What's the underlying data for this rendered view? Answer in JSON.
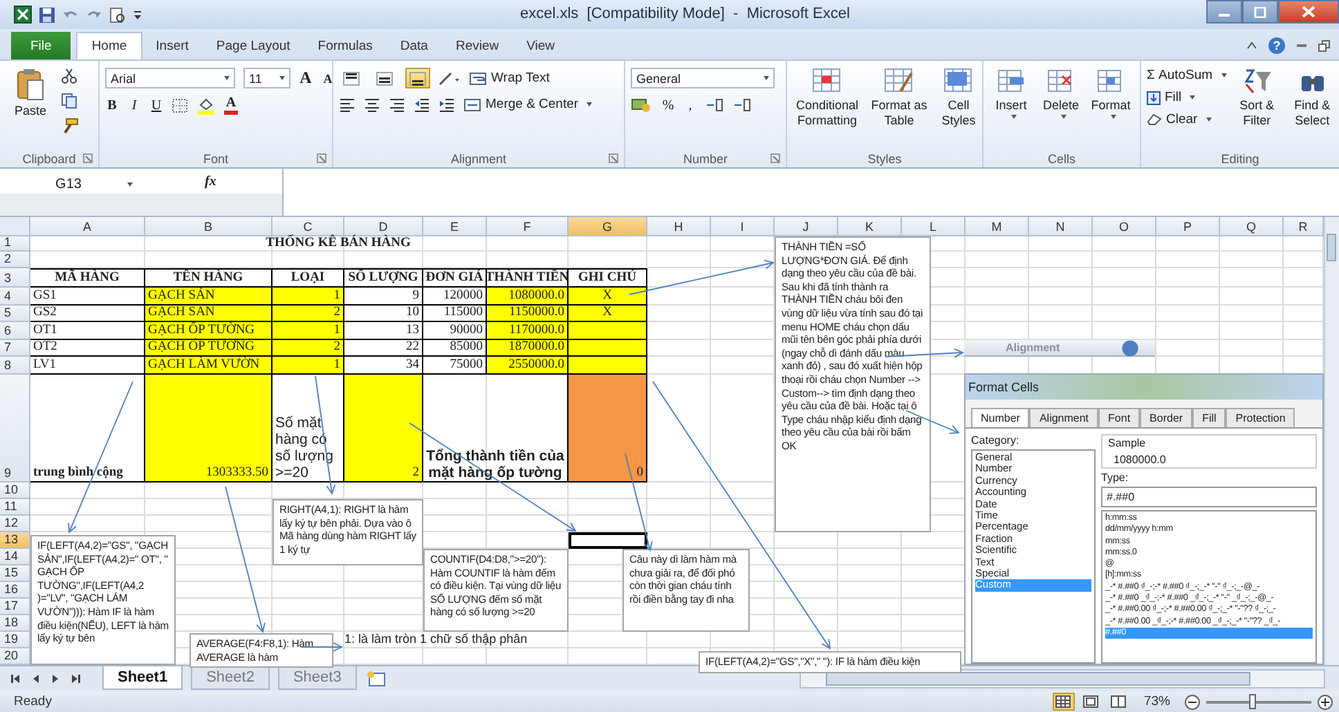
{
  "window": {
    "title": "excel.xls  [Compatibility Mode]  -  Microsoft Excel"
  },
  "ribbon_tabs": [
    {
      "label": "File",
      "kind": "file",
      "selected": false
    },
    {
      "label": "Home",
      "kind": "tab",
      "selected": true
    },
    {
      "label": "Insert",
      "kind": "tab",
      "selected": false
    },
    {
      "label": "Page Layout",
      "kind": "tab",
      "selected": false
    },
    {
      "label": "Formulas",
      "kind": "tab",
      "selected": false
    },
    {
      "label": "Data",
      "kind": "tab",
      "selected": false
    },
    {
      "label": "Review",
      "kind": "tab",
      "selected": false
    },
    {
      "label": "View",
      "kind": "tab",
      "selected": false
    }
  ],
  "help": "?",
  "ribbon": {
    "clipboard": {
      "paste": "Paste",
      "label": "Clipboard"
    },
    "font": {
      "name": "Arial",
      "size": "11",
      "grow": "A",
      "shrink": "A",
      "styles": [
        "B",
        "I",
        "U"
      ],
      "font_color": "A",
      "label": "Font"
    },
    "alignment": {
      "vertical": [
        {
          "selected": false
        },
        {
          "selected": false
        },
        {
          "selected": true
        }
      ],
      "wrap_text": "Wrap Text",
      "merge": "Merge & Center",
      "label": "Alignment"
    },
    "number": {
      "format": "General",
      "percent": "%",
      "comma": ",",
      "label": "Number"
    },
    "styles": {
      "buttons": [
        "Conditional Formatting",
        "Format as Table",
        "Cell Styles"
      ],
      "label": "Styles"
    },
    "cells": {
      "buttons": [
        "Insert",
        "Delete",
        "Format"
      ],
      "label": "Cells"
    },
    "editing": {
      "sigma": "Σ",
      "autosum": "AutoSum",
      "fill": "Fill",
      "clear": "Clear",
      "sort": "Sort & Filter",
      "find": "Find & Select",
      "label": "Editing"
    }
  },
  "formula_bar": {
    "name_box": "G13",
    "fx": "fx"
  },
  "sheet": {
    "columns": [
      {
        "label": "A",
        "selected": false
      },
      {
        "label": "B",
        "selected": false
      },
      {
        "label": "C",
        "selected": false
      },
      {
        "label": "D",
        "selected": false
      },
      {
        "label": "E",
        "selected": false
      },
      {
        "label": "F",
        "selected": false
      },
      {
        "label": "G",
        "selected": true
      },
      {
        "label": "H",
        "selected": false
      },
      {
        "label": "I",
        "selected": false
      },
      {
        "label": "J",
        "selected": false
      },
      {
        "label": "K",
        "selected": false
      },
      {
        "label": "L",
        "selected": false
      },
      {
        "label": "M",
        "selected": false
      },
      {
        "label": "N",
        "selected": false
      },
      {
        "label": "O",
        "selected": false
      },
      {
        "label": "P",
        "selected": false
      },
      {
        "label": "Q",
        "selected": false
      },
      {
        "label": "R",
        "selected": false
      }
    ],
    "rows": [
      {
        "number": "1",
        "selected": false
      },
      {
        "number": "2",
        "selected": false
      },
      {
        "number": "3",
        "selected": false
      },
      {
        "number": "4",
        "selected": false
      },
      {
        "number": "5",
        "selected": false
      },
      {
        "number": "6",
        "selected": false
      },
      {
        "number": "7",
        "selected": false
      },
      {
        "number": "8",
        "selected": false
      },
      {
        "number": "9",
        "selected": false
      },
      {
        "number": "10",
        "selected": false
      },
      {
        "number": "11",
        "selected": false
      },
      {
        "number": "12",
        "selected": false
      },
      {
        "number": "13",
        "selected": true
      },
      {
        "number": "14",
        "selected": false
      },
      {
        "number": "15",
        "selected": false
      },
      {
        "number": "16",
        "selected": false
      },
      {
        "number": "17",
        "selected": false
      },
      {
        "number": "18",
        "selected": false
      },
      {
        "number": "19",
        "selected": false,
        "text": "1: là làm tròn 1 chữ số thập phân"
      },
      {
        "number": "20",
        "selected": false
      }
    ],
    "title": "THỐNG KÊ BÁN HÀNG",
    "table": [
      {
        "kind": "header",
        "cells": [
          {
            "text": "MÃ HÀNG"
          },
          {
            "text": "TÊN HÀNG"
          },
          {
            "text": "LOẠI"
          },
          {
            "text": "SỐ LƯỢNG"
          },
          {
            "text": "ĐƠN GIÁ"
          },
          {
            "text": "THÀNH TIỀN"
          },
          {
            "text": "GHI CHÚ"
          }
        ]
      },
      {
        "kind": "data",
        "cells": [
          {
            "text": "GS1"
          },
          {
            "text": "GẠCH SẢN",
            "color": "#ffff00"
          },
          {
            "text": "1",
            "color": "#ffff00"
          },
          {
            "text": "9"
          },
          {
            "text": "120000"
          },
          {
            "text": "1080000.0",
            "color": "#ffff00"
          },
          {
            "text": "X",
            "color": "#ffff00"
          }
        ]
      },
      {
        "kind": "data",
        "cells": [
          {
            "text": "GS2"
          },
          {
            "text": "GẠCH SẢN",
            "color": "#ffff00"
          },
          {
            "text": "2",
            "color": "#ffff00"
          },
          {
            "text": "10"
          },
          {
            "text": "115000"
          },
          {
            "text": "1150000.0",
            "color": "#ffff00"
          },
          {
            "text": "X",
            "color": "#ffff00"
          }
        ]
      },
      {
        "kind": "data",
        "cells": [
          {
            "text": "OT1"
          },
          {
            "text": " GẠCH ỐP TƯỜNG",
            "color": "#ffff00"
          },
          {
            "text": "1",
            "color": "#ffff00"
          },
          {
            "text": "13"
          },
          {
            "text": "90000"
          },
          {
            "text": "1170000.0",
            "color": "#ffff00"
          },
          {
            "color": "#ffff00"
          }
        ]
      },
      {
        "kind": "data",
        "cells": [
          {
            "text": "OT2"
          },
          {
            "text": " GẠCH ỐP TƯỜNG",
            "color": "#ffff00"
          },
          {
            "text": "2",
            "color": "#ffff00"
          },
          {
            "text": "22"
          },
          {
            "text": "85000"
          },
          {
            "text": "1870000.0",
            "color": "#ffff00"
          },
          {
            "color": "#ffff00"
          }
        ]
      },
      {
        "kind": "data",
        "cells": [
          {
            "text": "LV1"
          },
          {
            "text": "GẠCH LÀM VƯỜN",
            "color": "#ffff00"
          },
          {
            "text": "1",
            "color": "#ffff00"
          },
          {
            "text": "34"
          },
          {
            "text": "75000"
          },
          {
            "text": "2550000.0",
            "color": "#ffff00"
          },
          {
            "color": "#ffff00"
          }
        ]
      },
      {
        "kind": "summary",
        "cells": [
          {
            "text": "trung bình cộng"
          },
          {
            "text": "1303333.50",
            "color": "#ffff00"
          },
          {
            "text": "Số mặt hàng có số lượng >=20"
          },
          {
            "text": "2",
            "color": "#ffff00"
          },
          {
            "text": "Tổng thành tiền của mặt hàng ốp tường"
          },
          {
            "text": "0",
            "color": "#f79646"
          }
        ]
      }
    ]
  },
  "notes": [
    {
      "kind": "box",
      "text": "THÀNH TIỀN =SỐ LƯỢNG*ĐƠN GIÁ. Để định dạng theo yêu cầu của đề bài. Sau khi đã tính thành ra THÀNH TIỀN cháu bôi đen vùng dữ liệu vừa tính sau đó tại menu HOME cháu chọn dấu mũi tên bên góc phải phía dưới (ngay chỗ dì đánh dấu màu xanh đỏ) , sau đó xuất hiện hộp thoại  rồi cháu chọn Number --> Custom--> tìm định dạng theo yêu cầu của đề bài. Hoặc tại ô Type cháu nhập kiểu định dạng theo yêu cầu của bài rồi bấm OK"
    },
    {
      "kind": "box",
      "text": "IF(LEFT(A4,2)=\"GS\", \"GẠCH SẢN\",IF(LEFT(A4,2)=\" OT\", \" GẠCH ỐP TƯỜNG\",IF(LEFT(A4,2 )=\"LV\", \"GẠCH LÁM VƯỜN\"))):  Hàm IF là hàm điều kiện(NẾU), LEFT là hàm lấy ký tự bên"
    },
    {
      "kind": "box",
      "text": "RIGHT(A4,1):  RIGHT là hàm lấy ký tự bên phải. Dựa vào ô Mã hàng  dùng hàm RIGHT lấy 1 ký tự"
    },
    {
      "kind": "box",
      "text": "COUNTIF(D4:D8,\">=20\"): Hàm COUNTIF là hàm đếm có điều kiện. Tại vùng dữ liệu SỐ LƯỢNG đếm số mặt hàng có số lượng >=20"
    },
    {
      "kind": "box",
      "text": "Câu này dì làm hàm mà chưa giải ra, để đối phó còn thời gian cháu tính rồi điền bằng tay đi nha"
    },
    {
      "kind": "box",
      "text": "AVERAGE(F4:F8,1): Hàm AVERAGE là hàm"
    },
    {
      "kind": "box",
      "text": "IF(LEFT(A4,2)=\"GS\",\"X\",\"  \"): IF là hàm điều kiện"
    }
  ],
  "alignment_snippet": {
    "label": "Alignment"
  },
  "format_cells": {
    "title": "Format Cells",
    "tabs": [
      {
        "label": "Number",
        "selected": true
      },
      {
        "label": "Alignment",
        "selected": false
      },
      {
        "label": "Font",
        "selected": false
      },
      {
        "label": "Border",
        "selected": false
      },
      {
        "label": "Fill",
        "selected": false
      },
      {
        "label": "Protection",
        "selected": false
      }
    ],
    "category_label": "Category:",
    "categories": [
      {
        "label": "General",
        "selected": false
      },
      {
        "label": "Number",
        "selected": false
      },
      {
        "label": "Currency",
        "selected": false
      },
      {
        "label": "Accounting",
        "selected": false
      },
      {
        "label": "Date",
        "selected": false
      },
      {
        "label": "Time",
        "selected": false
      },
      {
        "label": "Percentage",
        "selected": false
      },
      {
        "label": "Fraction",
        "selected": false
      },
      {
        "label": "Scientific",
        "selected": false
      },
      {
        "label": "Text",
        "selected": false
      },
      {
        "label": "Special",
        "selected": false
      },
      {
        "label": "Custom",
        "selected": true
      }
    ],
    "sample_label": "Sample",
    "sample": "1080000.0",
    "type_label": "Type:",
    "type_value": "#.##0",
    "formats": [
      {
        "label": "h:mm:ss",
        "selected": false
      },
      {
        "label": "dd/mm/yyyy h:mm",
        "selected": false
      },
      {
        "label": "mm:ss",
        "selected": false
      },
      {
        "label": "mm:ss.0",
        "selected": false
      },
      {
        "label": "@",
        "selected": false
      },
      {
        "label": "[h]:mm:ss",
        "selected": false
      },
      {
        "label": "_-* #.##0 ₫_-;-* #.##0 ₫_-;_-* \"-\" ₫_-;_-@_-",
        "selected": false
      },
      {
        "label": "_-* #.##0 _₫_-;-* #.##0 _₫_-;_-* \"-\" _₫_-;_-@_-",
        "selected": false
      },
      {
        "label": "_-* #.##0.00 ₫_-;-* #.##0.00 ₫_-;_-* \"-\"?? ₫_-;_-",
        "selected": false
      },
      {
        "label": "_-* #.##0.00 _₫_-;-* #.##0.00 _₫_-;_-* \"-\"?? _₫_-",
        "selected": false
      },
      {
        "label": "#.##0",
        "selected": true
      }
    ]
  },
  "sheet_tabs": [
    {
      "label": "Sheet1",
      "selected": true
    },
    {
      "label": "Sheet2",
      "selected": false
    },
    {
      "label": "Sheet3",
      "selected": false
    }
  ],
  "status_bar": {
    "status": "Ready",
    "views": [
      {
        "kind": "normal",
        "selected": true
      },
      {
        "kind": "page_layout",
        "selected": false
      },
      {
        "kind": "page_break",
        "selected": false
      }
    ],
    "zoom": "73%",
    "zoom_slider": {
      "level": 0.45
    }
  }
}
